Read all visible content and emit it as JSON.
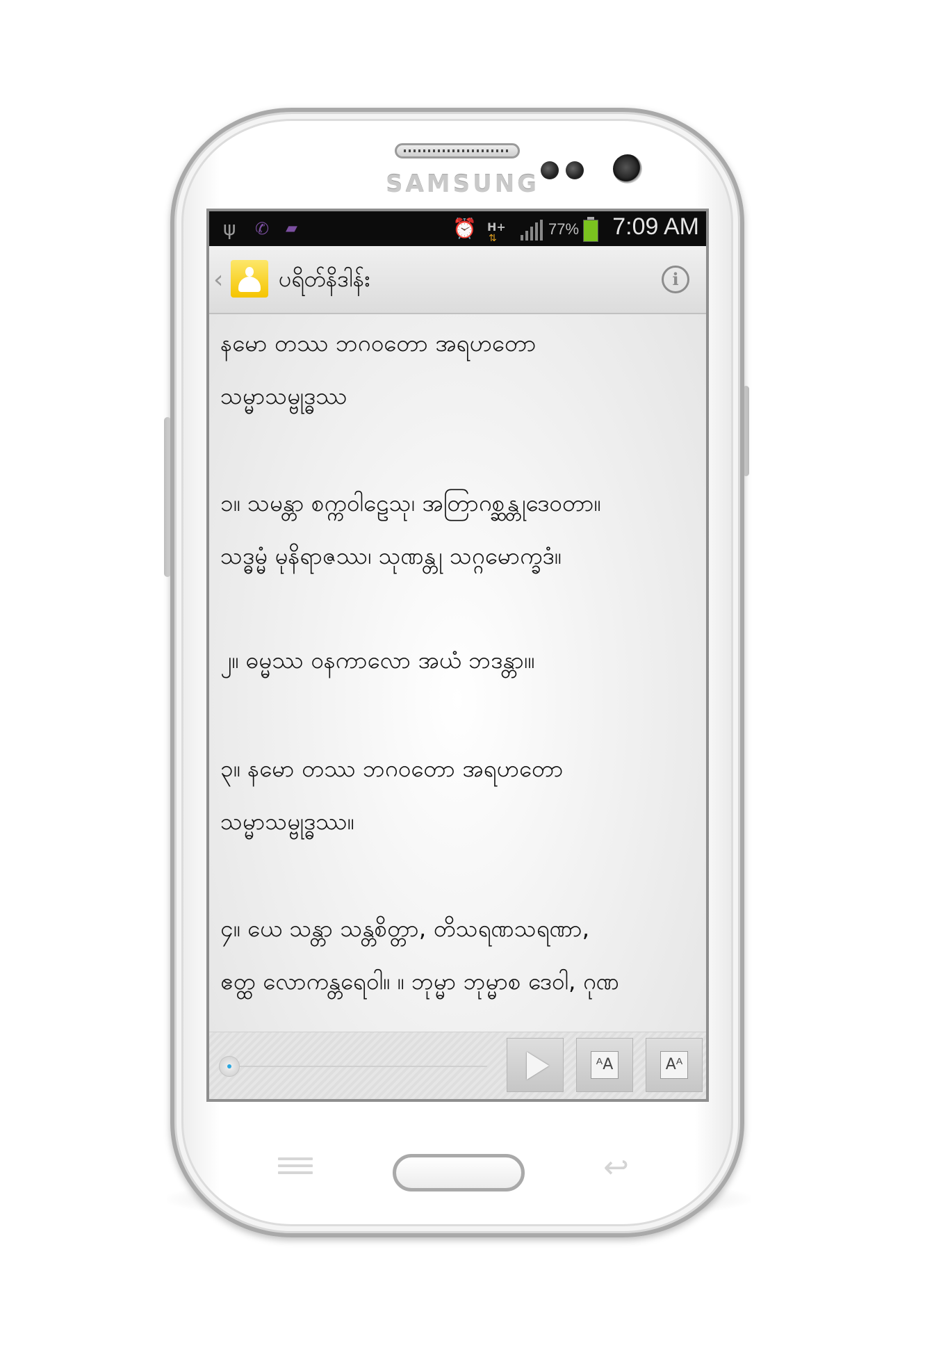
{
  "device": {
    "brand": "SAMSUNG"
  },
  "status_bar": {
    "battery_percent": "77%",
    "time": "7:09 AM",
    "network_type": "H+",
    "icons": [
      "usb-icon",
      "missed-call-icon",
      "chat-icon",
      "alarm-icon",
      "data-arrows-icon",
      "signal-icon",
      "battery-charging-icon"
    ]
  },
  "app_bar": {
    "title": "ပရိတ်နိဒါန်း",
    "back_icon": "chevron-left-icon",
    "app_icon": "buddha-icon",
    "info_icon": "info-icon",
    "info_glyph": "i"
  },
  "content": {
    "paragraphs": [
      {
        "lines": [
          "နမော တဿ ဘဂဝတော အရဟတော",
          "သမ္မာသမ္ဗုဒ္ဓဿ"
        ]
      },
      {
        "lines": [
          "၁။ သမန္တာ စက္ကဝါဠေသု၊ အတြာဂစ္ဆန္တုဒေဝတာ။",
          "သဒ္ဓမ္မံ မုနိရာဇဿ၊ သုဏန္တု သဂ္ဂမောက္ခဒံ။"
        ]
      },
      {
        "lines": [
          "၂။ ဓမ္မဿ ဝနကာလော အယံ ဘဒန္တာ၊။"
        ]
      },
      {
        "lines": [
          "၃။ နမော တဿ ဘဂဝတော အရဟတော",
          "သမ္မာသမ္ဗုဒ္ဓဿ။"
        ]
      },
      {
        "lines": [
          "၄။ ယေ သန္တာ သန္တစိတ္တာ, တိသရဏသရဏာ,",
          "ဧတ္ထ လောကန္တရေဝါ။ ။ ဘုမ္မာ ဘုမ္မာစ ဒေဝါ, ဂုဏ"
        ]
      }
    ]
  },
  "player": {
    "play_icon": "play-icon",
    "font_decrease_icon": "font-size-small-icon",
    "font_increase_icon": "font-size-large-icon",
    "font_small_glyph": "ᴬA",
    "font_large_glyph": "Aᴬ",
    "progress": 0.0
  },
  "hardware_keys": {
    "menu_icon": "menu-icon",
    "home_icon": "home-button",
    "back_icon": "back-arrow-icon",
    "back_glyph": "↩"
  },
  "colors": {
    "status_bar": "#0c0c0c",
    "app_bar": "#e6e6e6",
    "accent": "#2aa7e0",
    "app_icon": "#f8d02a",
    "battery": "#7ac31f"
  }
}
